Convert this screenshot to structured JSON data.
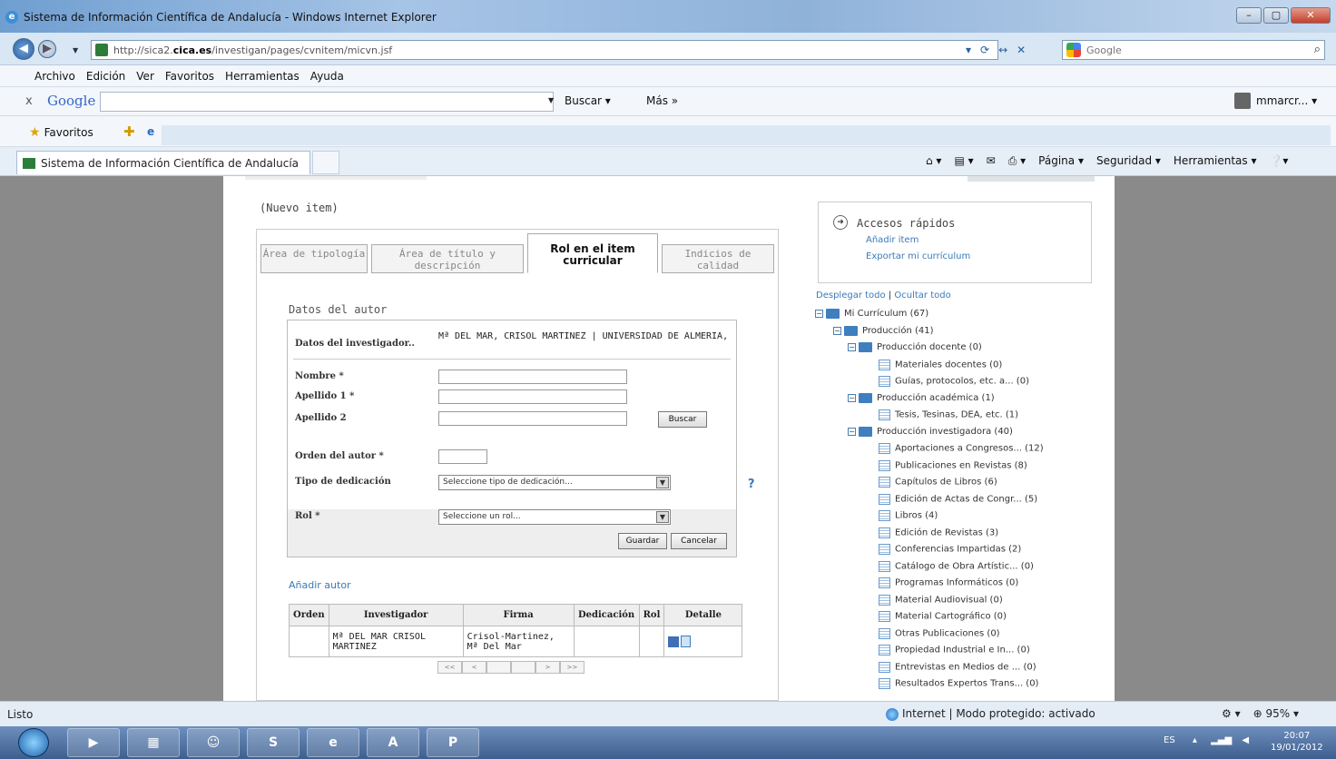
{
  "window": {
    "title": "Sistema de Información Científica de Andalucía - Windows Internet Explorer",
    "controls": [
      "–",
      "▢",
      "✕"
    ]
  },
  "address": {
    "url_prefix": "http://sica2.",
    "url_domain": "cica.es",
    "url_path": "/investigan/pages/cvnitem/micvn.jsf",
    "search_engine": "Google",
    "ctrl_icons": [
      "▾",
      "⟳",
      "↔",
      "✕"
    ]
  },
  "menu": [
    "Archivo",
    "Edición",
    "Ver",
    "Favoritos",
    "Herramientas",
    "Ayuda"
  ],
  "google_bar": {
    "close": "x",
    "logo": "Google",
    "buscar": "Buscar",
    "mas": "Más »",
    "user": "mmarcr..."
  },
  "favorites": {
    "label": "Favoritos"
  },
  "tab": {
    "title": "Sistema de Información Científica de Andalucía",
    "tools": [
      "Página ▾",
      "Seguridad ▾",
      "Herramientas ▾"
    ]
  },
  "page": {
    "nuevo_item": "(Nuevo item)",
    "form_tabs": [
      {
        "label": "Área de tipología",
        "active": false
      },
      {
        "label": "Área de título y descripción",
        "active": false
      },
      {
        "label": "Rol en el item curricular",
        "active": true
      },
      {
        "label": "Indicios de calidad",
        "active": false
      }
    ],
    "datos_title": "Datos del autor",
    "datos_investigador_label": "Datos del investigador..",
    "datos_investigador_value": "Mª DEL MAR, CRISOL MARTINEZ | UNIVERSIDAD DE ALMERIA,",
    "nombre_label": "Nombre *",
    "apellido1_label": "Apellido 1 *",
    "apellido2_label": "Apellido 2",
    "buscar_btn": "Buscar",
    "orden_label": "Orden del autor *",
    "tipo_label": "Tipo de dedicación",
    "tipo_value": "Seleccione tipo de dedicación...",
    "rol_label": "Rol *",
    "rol_value": "Seleccione un rol...",
    "guardar_btn": "Guardar",
    "cancelar_btn": "Cancelar",
    "help": "?",
    "add_autor": "Añadir autor",
    "table": {
      "headers": [
        "Orden",
        "Investigador",
        "Firma",
        "Dedicación",
        "Rol",
        "Detalle"
      ],
      "rows": [
        {
          "orden": "",
          "investigador": "Mª DEL MAR CRISOL MARTINEZ",
          "firma": "Crisol-Martinez, Mª Del Mar",
          "dedicacion": "",
          "rol": ""
        }
      ]
    },
    "pager": [
      "<<",
      "<",
      "",
      "",
      ">",
      ">>"
    ],
    "quick": {
      "title": "Accesos rápidos",
      "link1": "Añadir item",
      "link2": "Exportar mi currículum"
    },
    "tree_ctrl": {
      "expand": "Desplegar todo",
      "sep": "|",
      "collapse": "Ocultar todo"
    },
    "tree": [
      {
        "label": "Mi Currículum (67)",
        "level": 0,
        "type": "folder"
      },
      {
        "label": "Producción (41)",
        "level": 1,
        "type": "folder"
      },
      {
        "label": "Producción docente (0)",
        "level": 2,
        "type": "folder"
      },
      {
        "label": "Materiales docentes (0)",
        "level": 3,
        "type": "doc"
      },
      {
        "label": "Guías, protocolos, etc. a... (0)",
        "level": 3,
        "type": "doc"
      },
      {
        "label": "Producción académica (1)",
        "level": 2,
        "type": "folder"
      },
      {
        "label": "Tesis, Tesinas, DEA, etc. (1)",
        "level": 3,
        "type": "doc"
      },
      {
        "label": "Producción investigadora (40)",
        "level": 2,
        "type": "folder"
      },
      {
        "label": "Aportaciones a Congresos... (12)",
        "level": 3,
        "type": "doc"
      },
      {
        "label": "Publicaciones en Revistas (8)",
        "level": 3,
        "type": "doc"
      },
      {
        "label": "Capítulos de Libros (6)",
        "level": 3,
        "type": "doc"
      },
      {
        "label": "Edición de Actas de Congr... (5)",
        "level": 3,
        "type": "doc"
      },
      {
        "label": "Libros (4)",
        "level": 3,
        "type": "doc"
      },
      {
        "label": "Edición de Revistas (3)",
        "level": 3,
        "type": "doc"
      },
      {
        "label": "Conferencias Impartidas (2)",
        "level": 3,
        "type": "doc"
      },
      {
        "label": "Catálogo de Obra Artístic... (0)",
        "level": 3,
        "type": "doc"
      },
      {
        "label": "Programas Informáticos (0)",
        "level": 3,
        "type": "doc"
      },
      {
        "label": "Material Audiovisual (0)",
        "level": 3,
        "type": "doc"
      },
      {
        "label": "Material Cartográfico (0)",
        "level": 3,
        "type": "doc"
      },
      {
        "label": "Otras Publicaciones (0)",
        "level": 3,
        "type": "doc"
      },
      {
        "label": "Propiedad Industrial e In... (0)",
        "level": 3,
        "type": "doc"
      },
      {
        "label": "Entrevistas en Medios de ... (0)",
        "level": 3,
        "type": "doc"
      },
      {
        "label": "Resultados Expertos Trans... (0)",
        "level": 3,
        "type": "doc"
      }
    ]
  },
  "status": {
    "left": "Listo",
    "zone": "Internet | Modo protegido: activado",
    "zoom": "⊕ 95%  ▾"
  },
  "taskbar": {
    "lang": "ES",
    "time": "20:07",
    "date": "19/01/2012"
  }
}
